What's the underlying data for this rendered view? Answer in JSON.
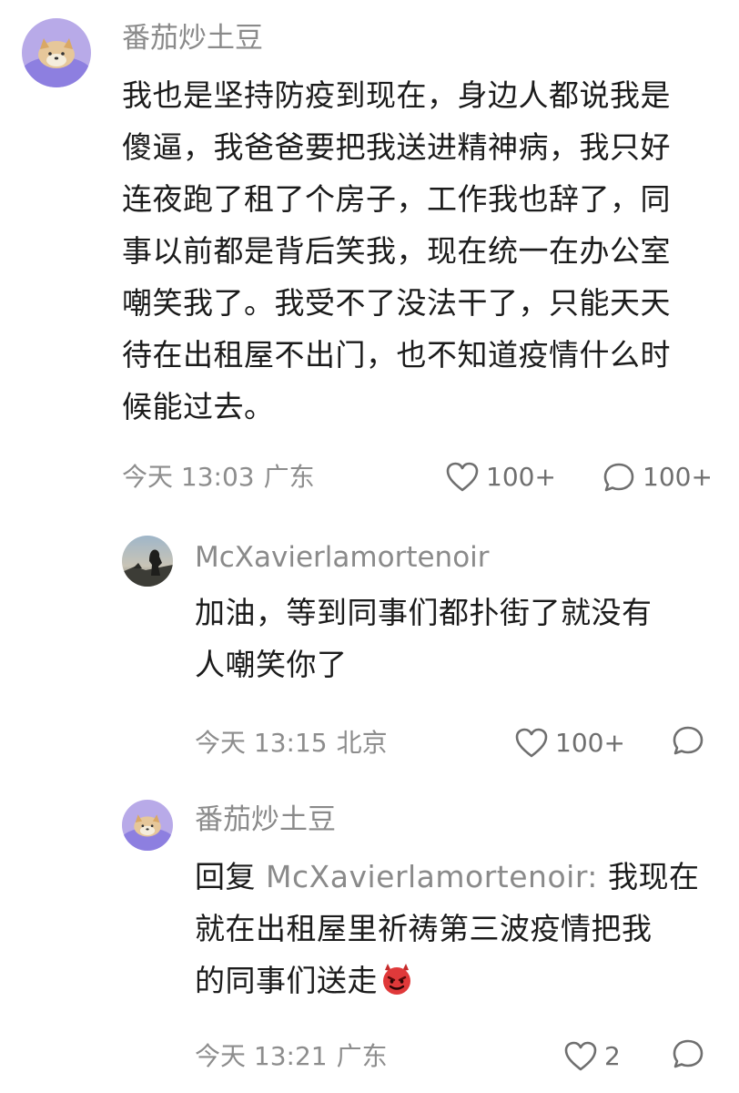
{
  "comments": [
    {
      "username": "番茄炒土豆",
      "lines": [
        "我也是坚持防疫到现在，身边人都说我是",
        "傻逼，我爸爸要把我送进精神病，我只好",
        "连夜跑了租了个房子，工作我也辞了，同",
        "事以前都是背后笑我，现在统一在办公室",
        "嘲笑我了。我受不了没法干了，只能天天",
        "待在出租屋不出门，也不知道疫情什么时",
        "候能过去。"
      ],
      "time": "今天 13:03",
      "location": "广东",
      "likes": "100+",
      "replies": "100+"
    },
    {
      "username": "McXavierlamortenoir",
      "lines": [
        "加油，等到同事们都扑街了就没有",
        "人嘲笑你了"
      ],
      "time": "今天 13:15",
      "location": "北京",
      "likes": "100+",
      "replies": ""
    },
    {
      "username": "番茄炒土豆",
      "reply_prefix": "回复",
      "reply_target": "McXavierlamortenoir:",
      "lines": [
        "我现在",
        "就在出租屋里祈祷第三波疫情把我",
        "的同事们送走"
      ],
      "emoji": "devil-face-emoji",
      "time": "今天 13:21",
      "location": "广东",
      "likes": "2",
      "replies": ""
    }
  ],
  "colors": {
    "text": "#1b1b1b",
    "muted": "#8a8a8a",
    "icon": "#6f6f6f",
    "avatar_bg": "#b9a9e6"
  },
  "icons": {
    "like": "heart-outline-icon",
    "reply": "speech-bubble-outline-icon"
  }
}
